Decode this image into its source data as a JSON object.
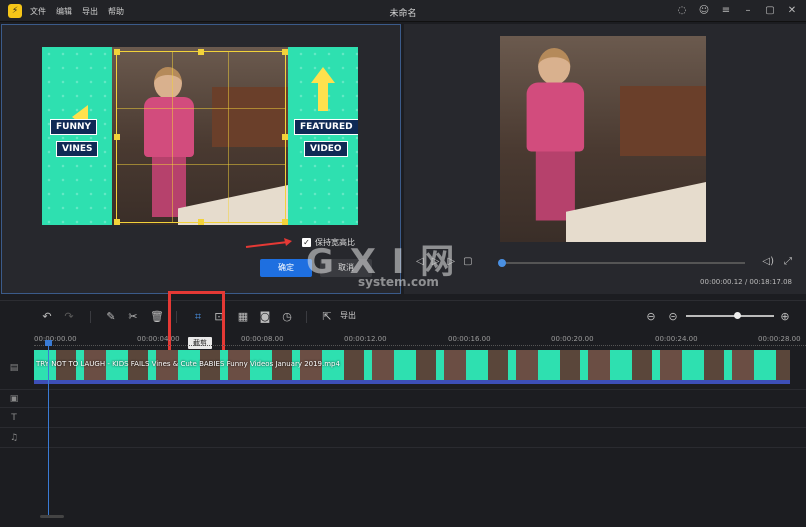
{
  "app": {
    "title": "未命名",
    "logo": "logo"
  },
  "menu": [
    "文件",
    "编辑",
    "导出",
    "帮助"
  ],
  "crop_panel": {
    "left_banner": [
      "FUNNY",
      "VINES"
    ],
    "right_banner": [
      "FEATURED",
      "VIDEO"
    ],
    "keep_ratio_label": "保持宽高比",
    "keep_ratio_checked": true,
    "ok_label": "确定",
    "cancel_label": "取消"
  },
  "preview": {
    "time_current": "00:00:00.12",
    "time_total": "00:18:17.08",
    "timecode": "00:00:00.12 / 00:18:17.08",
    "progress_fraction": 0.01
  },
  "toolbar": {
    "export_label": "导出",
    "crop_tooltip": "截剪",
    "zoom_fraction": 0.55
  },
  "timeline": {
    "ruler_ticks": [
      "00:00:00.00",
      "00:00:04.00",
      "00:00:08.00",
      "00:00:12.00",
      "00:00:16.00",
      "00:00:20.00",
      "00:00:24.00",
      "00:00:28.00"
    ],
    "clip_name": "TRY NOT TO LAUGH - KIDS FAILS Vines & Cute BABIES  Funny Videos January 2019.mp4"
  },
  "watermark": {
    "line1": "G X I 网",
    "line2": "system.com"
  },
  "colors": {
    "accent": "#1e6fe0",
    "highlight": "#e53935",
    "crop": "#f2d23a",
    "clip": "#2ee0b0"
  }
}
